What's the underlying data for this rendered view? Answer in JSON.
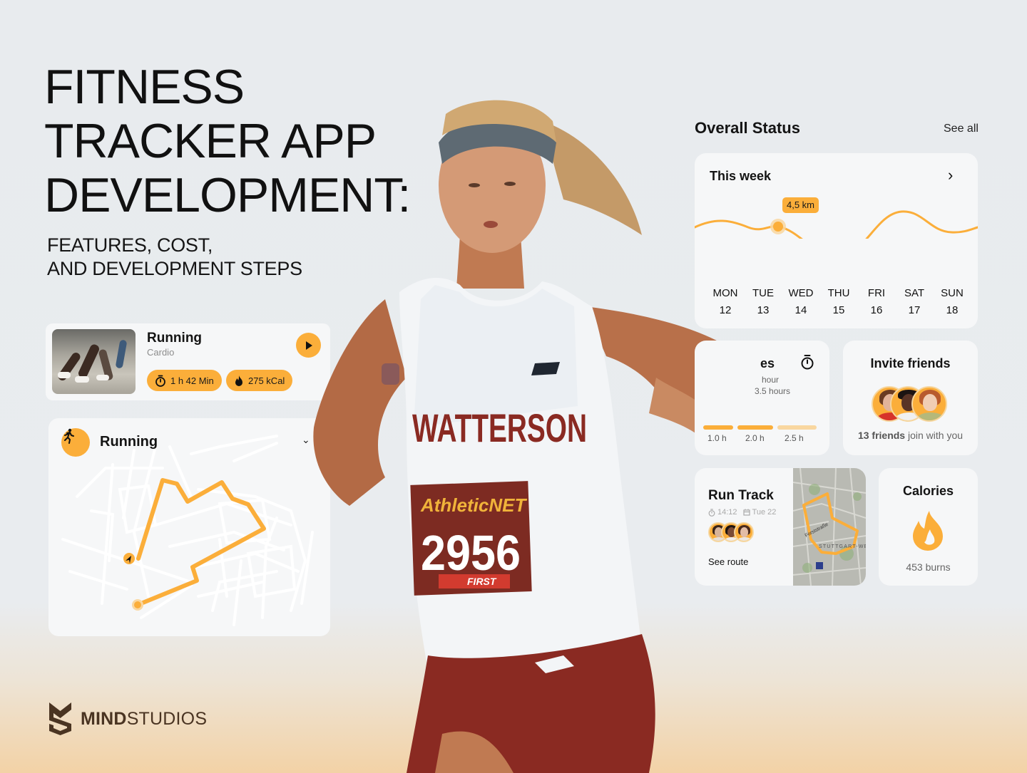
{
  "hero": {
    "title_lines": [
      "FITNESS",
      "TRACKER APP",
      "DEVELOPMENT:"
    ],
    "subtitle_lines": [
      "FEATURES, COST,",
      "AND DEVELOPMENT STEPS"
    ]
  },
  "workout_card": {
    "title": "Running",
    "category": "Cardio",
    "duration": "1 h 42 Min",
    "calories": "275 kCal",
    "play_icon": "play-icon",
    "duration_icon": "stopwatch-icon",
    "calories_icon": "flame-icon"
  },
  "run_map_card": {
    "title": "Running",
    "icon": "runner-icon",
    "expand_icon": "chevron-down-icon"
  },
  "runner_photo": {
    "jersey_name": "WATTERSON",
    "bib_brand": "AthleticNET",
    "bib_number": "2956",
    "bib_footer": "FIRST"
  },
  "overall_status": {
    "title": "Overall Status",
    "see_all": "See all",
    "week_card": {
      "title": "This week",
      "tooltip": "4,5 km",
      "days": [
        {
          "name": "MON",
          "date": "12"
        },
        {
          "name": "TUE",
          "date": "13"
        },
        {
          "name": "WED",
          "date": "14"
        },
        {
          "name": "THU",
          "date": "15"
        },
        {
          "name": "FRI",
          "date": "16"
        },
        {
          "name": "SAT",
          "date": "17"
        },
        {
          "name": "SUN",
          "date": "18"
        }
      ]
    },
    "minutes_card": {
      "title_visible": "es",
      "line1_visible": "hour",
      "line2_visible": "3.5 hours",
      "bar_labels": [
        "1.0 h",
        "2.0 h",
        "2.5 h"
      ],
      "icon": "stopwatch-icon"
    },
    "invite_card": {
      "title": "Invite friends",
      "count_bold": "13 friends",
      "count_rest": " join with you"
    },
    "run_track_card": {
      "title": "Run Track",
      "time": "14:12",
      "date": "Tue 22",
      "link": "See route",
      "map_label_street": "Forststraße",
      "map_label_area": "STUTTGART-WEST"
    },
    "calories_card": {
      "title": "Calories",
      "value": "453 burns",
      "icon": "flame-icon"
    }
  },
  "brand": {
    "bold": "MIND",
    "light": "STUDIOS"
  },
  "colors": {
    "accent": "#fbae3a",
    "accent_light": "#f9d7a0",
    "card_bg": "#f6f7f8",
    "page_bg": "#e8ebee",
    "brand": "#4a3422"
  }
}
